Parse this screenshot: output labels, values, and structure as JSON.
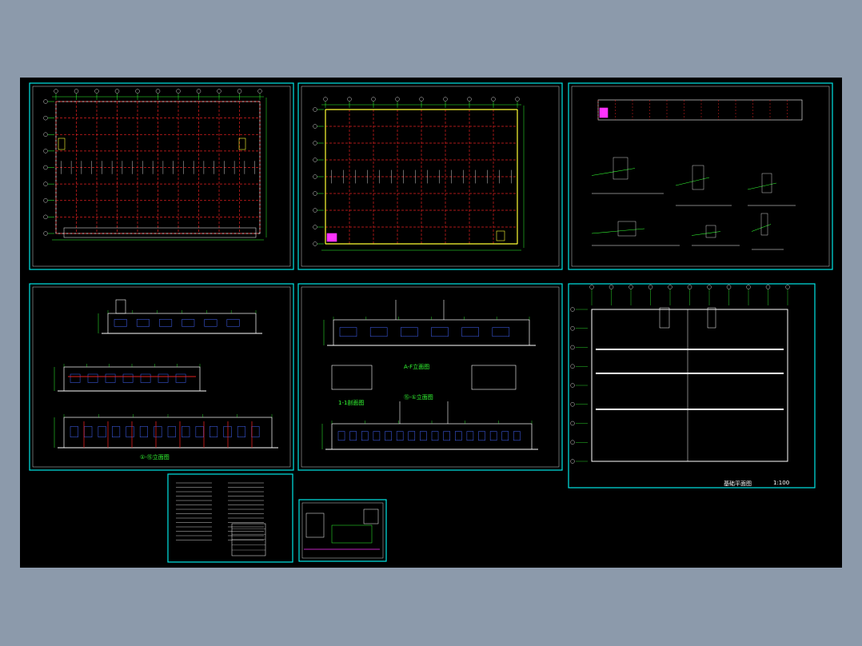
{
  "colors": {
    "background": "#8c9aab",
    "canvas": "#000000",
    "sheet_border": "#00e5e5",
    "grid_red": "#e02020",
    "line_white": "#ffffff",
    "dim_green": "#33ff33",
    "text_green": "#33ff33",
    "accent_yellow": "#ffff33",
    "accent_magenta": "#ff33ff",
    "accent_blue": "#4466ff"
  },
  "sheets": [
    {
      "id": "ground-floor-plan",
      "kind": "plan"
    },
    {
      "id": "roof-plan",
      "kind": "plan"
    },
    {
      "id": "section-details",
      "kind": "details"
    },
    {
      "id": "elevations-a",
      "kind": "elevations"
    },
    {
      "id": "elevations-b",
      "kind": "elevations"
    },
    {
      "id": "foundation-plan",
      "kind": "plan"
    },
    {
      "id": "design-notes",
      "kind": "notes"
    },
    {
      "id": "small-details",
      "kind": "details"
    }
  ],
  "labels": {
    "foundation_title": "基础平面图",
    "foundation_scale": "1:100",
    "elev_title_1": "①-⑮立面图",
    "elev_title_2": "A-F立面图",
    "elev_title_3": "⑮-①立面图",
    "elev_title_4": "1-1剖面图",
    "scale": "1:100"
  }
}
